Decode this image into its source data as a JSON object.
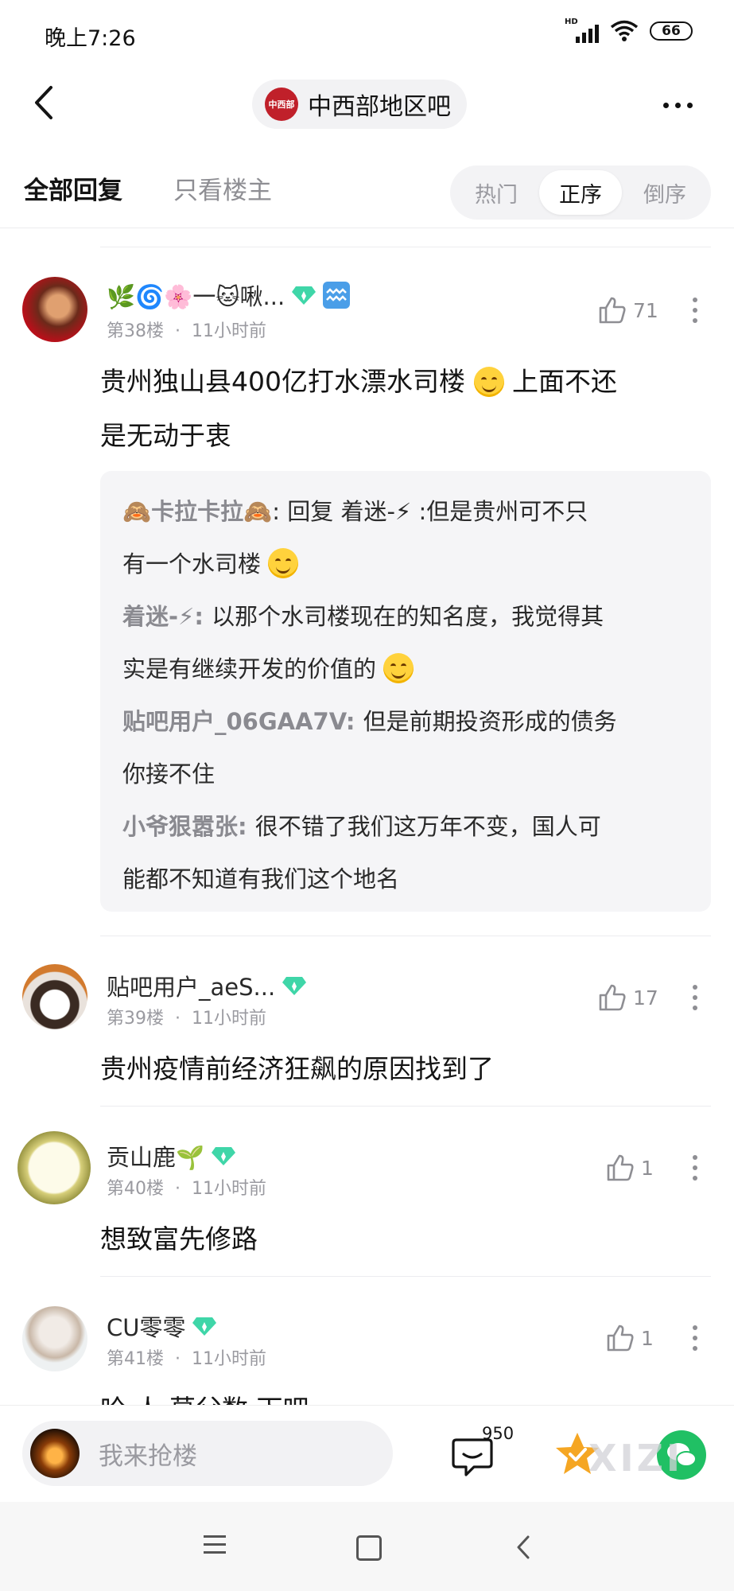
{
  "status_bar": {
    "time": "晚上7:26",
    "network": "HD",
    "battery": "66"
  },
  "header": {
    "forum_logo_text": "中西部",
    "forum_name": "中西部地区吧"
  },
  "filter": {
    "all_replies": "全部回复",
    "owner_only": "只看楼主",
    "sort_options": [
      "热门",
      "正序",
      "倒序"
    ],
    "active_sort": "正序"
  },
  "posts": [
    {
      "username": "🌿🌀🌸一🐱啾...",
      "floor": "第38楼",
      "time": "11小时前",
      "likes": "71",
      "content_line1": "贵州独山县400亿打水漂水司楼",
      "content_line1b": "上面不还",
      "content_line2": "是无动于衷",
      "replies": [
        {
          "name": "🙈卡拉卡拉🙈",
          "sep": ": ",
          "reply_to_label": "回复 ",
          "reply_to": "着迷-⚡",
          "text_a": " :但是贵州可不只",
          "text_b": "有一个水司楼"
        },
        {
          "name": "着迷-⚡",
          "sep": ": ",
          "text_a": "以那个水司楼现在的知名度，我觉得其",
          "text_b": "实是有继续开发的价值的"
        },
        {
          "name": "贴吧用户_06GAA7V",
          "sep": ": ",
          "text_a": "但是前期投资形成的债务",
          "text_b": "你接不住"
        },
        {
          "name": "小爷狠嚣张",
          "sep": ": ",
          "text_a": "很不错了我们这万年不变，国人可",
          "text_b": "能都不知道有我们这个地名"
        }
      ]
    },
    {
      "username": "贴吧用户_aeS...",
      "floor": "第39楼",
      "time": "11小时前",
      "likes": "17",
      "content": "贵州疫情前经济狂飙的原因找到了"
    },
    {
      "username": "贡山鹿🌱",
      "floor": "第40楼",
      "time": "11小时前",
      "likes": "1",
      "content": "想致富先修路"
    },
    {
      "username": "CU零零",
      "floor": "第41楼",
      "time": "11小时前",
      "likes": "1",
      "content": "哈 人 莫父数 下吧"
    }
  ],
  "meta_sep": "·",
  "bottom": {
    "input_placeholder": "我来抢楼",
    "comment_count": "950",
    "watermark": "XIZI"
  },
  "colors": {
    "accent_green": "#20c064",
    "star": "#f5a623",
    "gem": "#3fd6a8"
  }
}
